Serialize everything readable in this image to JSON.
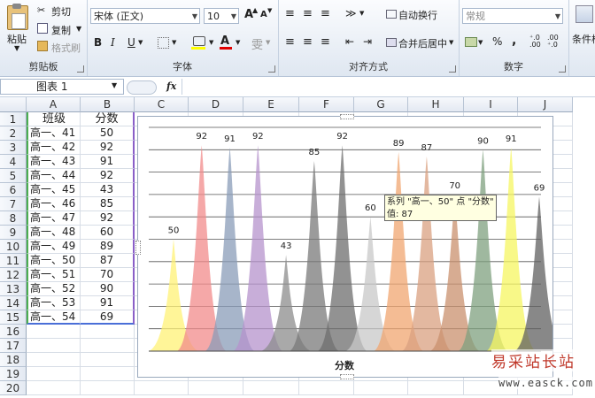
{
  "ribbon": {
    "clipboard": {
      "paste": "粘贴",
      "cut": "剪切",
      "copy": "复制",
      "format_painter": "格式刷",
      "label": "剪贴板"
    },
    "font": {
      "name": "宋体 (正文)",
      "size": "10",
      "bold": "B",
      "italic": "I",
      "underline": "U",
      "grow": "A",
      "shrink": "A",
      "wen": "雯",
      "label": "字体"
    },
    "alignment": {
      "wrap": "自动换行",
      "merge": "合并后居中",
      "label": "对齐方式"
    },
    "number": {
      "format": "常规",
      "percent": "%",
      "comma": ",",
      "inc_dec": "+.0\n.00",
      "dec_dec": ".00\n+.0",
      "label": "数字"
    },
    "conditional": {
      "label": "条件格"
    }
  },
  "formula_bar": {
    "name_box": "图表 1",
    "fx": "fx"
  },
  "columns": [
    "A",
    "B",
    "C",
    "D",
    "E",
    "F",
    "G",
    "H",
    "I",
    "J"
  ],
  "rows": [
    "1",
    "2",
    "3",
    "4",
    "5",
    "6",
    "7",
    "8",
    "9",
    "10",
    "11",
    "12",
    "13",
    "14",
    "15",
    "16",
    "17",
    "18",
    "19",
    "20"
  ],
  "sheet": {
    "header": [
      "班级",
      "分数"
    ],
    "data": [
      [
        "高一、41",
        "50"
      ],
      [
        "高一、42",
        "92"
      ],
      [
        "高一、43",
        "91"
      ],
      [
        "高一、44",
        "92"
      ],
      [
        "高一、45",
        "43"
      ],
      [
        "高一、46",
        "85"
      ],
      [
        "高一、47",
        "92"
      ],
      [
        "高一、48",
        "60"
      ],
      [
        "高一、49",
        "89"
      ],
      [
        "高一、50",
        "87"
      ],
      [
        "高一、51",
        "70"
      ],
      [
        "高一、52",
        "90"
      ],
      [
        "高一、53",
        "91"
      ],
      [
        "高一、54",
        "69"
      ]
    ]
  },
  "chart_data": {
    "type": "area",
    "categories": [
      "高一、41",
      "高一、42",
      "高一、43",
      "高一、44",
      "高一、45",
      "高一、46",
      "高一、47",
      "高一、48",
      "高一、49",
      "高一、50",
      "高一、51",
      "高一、52",
      "高一、53",
      "高一、54"
    ],
    "values": [
      50,
      92,
      91,
      92,
      43,
      85,
      92,
      60,
      89,
      87,
      70,
      90,
      91,
      69
    ],
    "colors": [
      "#fff176",
      "#f28b8b",
      "#8a9cb8",
      "#b593cc",
      "#8c8c8c",
      "#7a7a7a",
      "#6e6e6e",
      "#c8c8c8",
      "#f0a670",
      "#d9a080",
      "#c9906e",
      "#7fa07f",
      "#f5f560",
      "#606060"
    ],
    "title": "",
    "xlabel": "分数",
    "ylabel": "",
    "ylim": [
      0,
      100
    ],
    "grid": true
  },
  "tooltip": {
    "line1": "系列 \"高一、50\" 点 \"分数\"",
    "line2": "值: 87"
  },
  "watermark": {
    "text": "易采站长站",
    "url": "www.easck.com"
  }
}
